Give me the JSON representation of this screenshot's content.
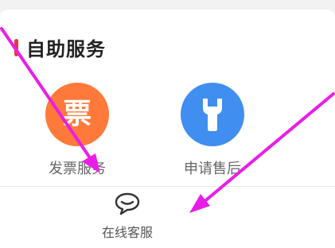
{
  "section": {
    "title": "自助服务"
  },
  "services": [
    {
      "label": "发票服务",
      "icon": "invoice-icon",
      "icon_text": "票",
      "color": "#ff7a3a"
    },
    {
      "label": "申请售后",
      "icon": "wrench-icon",
      "color": "#3f8ef0"
    }
  ],
  "bottom": {
    "customer_service_label": "在线客服",
    "icon": "chat-bubble-icon"
  },
  "colors": {
    "accent": "#e4393c",
    "arrow": "#e91ee6"
  }
}
